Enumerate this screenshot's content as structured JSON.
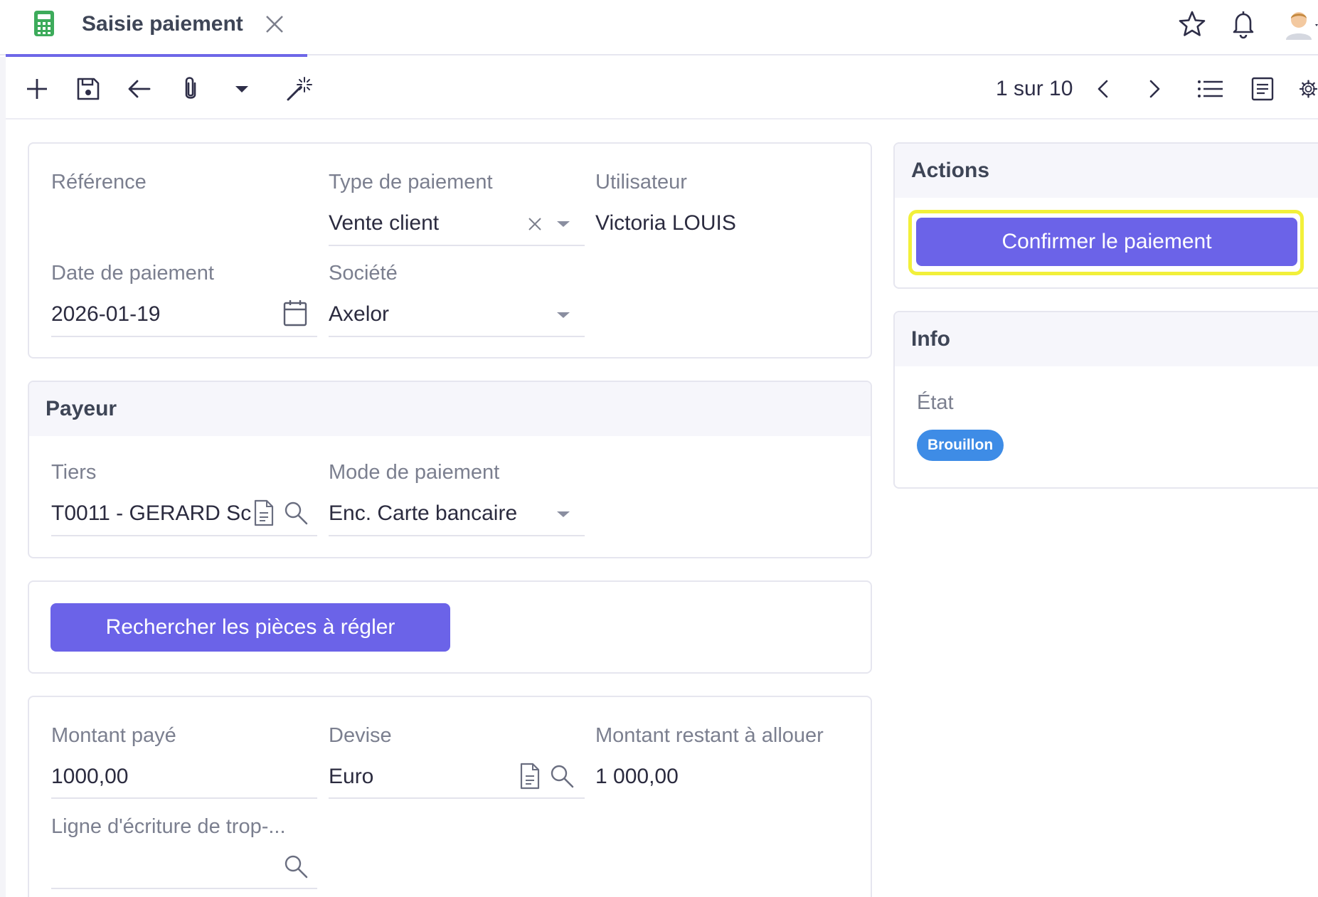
{
  "tab": {
    "title": "Saisie paiement"
  },
  "toolbar": {
    "pager": "1 sur 10"
  },
  "form": {
    "reference_label": "Référence",
    "reference_value": "",
    "payment_type_label": "Type de paiement",
    "payment_type_value": "Vente client",
    "user_label": "Utilisateur",
    "user_value": "Victoria LOUIS",
    "payment_date_label": "Date de paiement",
    "payment_date_value": "2026-01-19",
    "company_label": "Société",
    "company_value": "Axelor"
  },
  "payer": {
    "title": "Payeur",
    "partner_label": "Tiers",
    "partner_value": "T0011 - GERARD Sc",
    "mode_label": "Mode de paiement",
    "mode_value": "Enc. Carte bancaire"
  },
  "search_button": "Rechercher les pièces à régler",
  "amounts": {
    "paid_label": "Montant payé",
    "paid_value": "1000,00",
    "currency_label": "Devise",
    "currency_value": "Euro",
    "remaining_label": "Montant restant à allouer",
    "remaining_value": "1 000,00",
    "overpayment_label": "Ligne d'écriture de trop-..."
  },
  "actions": {
    "title": "Actions",
    "confirm_button": "Confirmer le paiement"
  },
  "info": {
    "title": "Info",
    "state_label": "État",
    "state_value": "Brouillon"
  },
  "colors": {
    "accent": "#6b63e8",
    "badge": "#3e8ce6",
    "highlight": "#f2f03a",
    "tab_icon": "#3dab5b"
  },
  "icons": [
    "calculator-icon",
    "close-icon",
    "star-icon",
    "bell-icon",
    "user-avatar",
    "plus-icon",
    "save-icon",
    "back-arrow-icon",
    "attachment-icon",
    "caret-down-icon",
    "magic-wand-icon",
    "chevron-left-icon",
    "chevron-right-icon",
    "list-view-icon",
    "form-view-icon",
    "gear-icon",
    "calendar-icon",
    "document-icon",
    "search-icon"
  ]
}
